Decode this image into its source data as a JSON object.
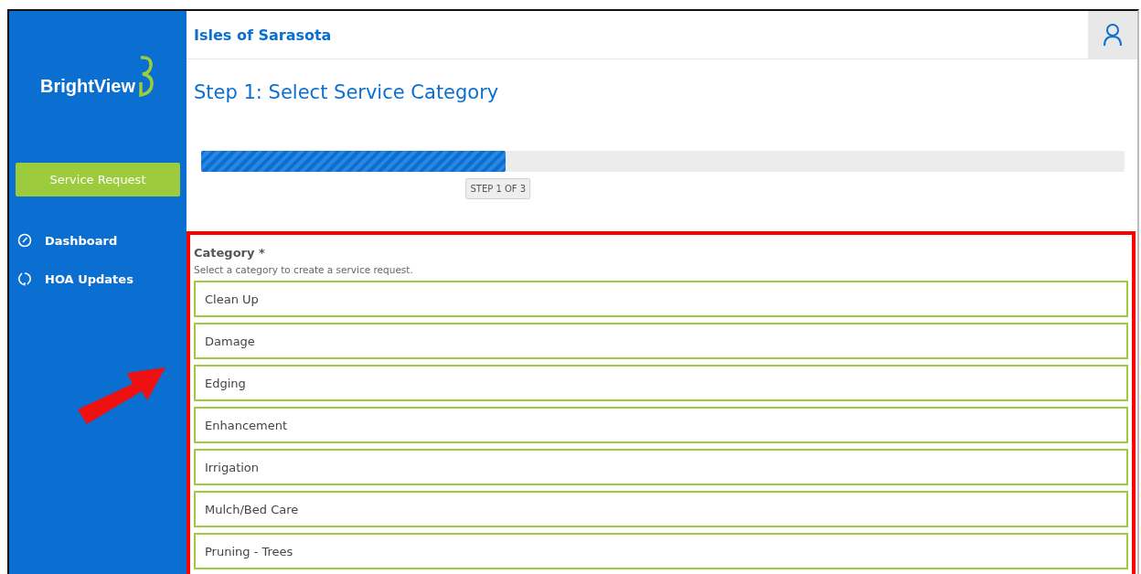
{
  "sidebar": {
    "logo": "BrightView",
    "action": "Service Request",
    "items": [
      {
        "label": "Dashboard",
        "kind": "dashboard"
      },
      {
        "label": "HOA Updates",
        "kind": "updates"
      }
    ]
  },
  "header": {
    "title": "Isles of Sarasota"
  },
  "page_title": "Step 1: Select Service Category",
  "progress": {
    "level": 0.33,
    "label": "STEP 1 OF 3"
  },
  "form": {
    "label": "Category *",
    "hint": "Select a category to create a service request.",
    "options": [
      {
        "label": "Clean Up"
      },
      {
        "label": "Damage"
      },
      {
        "label": "Edging"
      },
      {
        "label": "Enhancement"
      },
      {
        "label": "Irrigation"
      },
      {
        "label": "Mulch/Bed Care"
      },
      {
        "label": "Pruning - Trees"
      }
    ]
  }
}
